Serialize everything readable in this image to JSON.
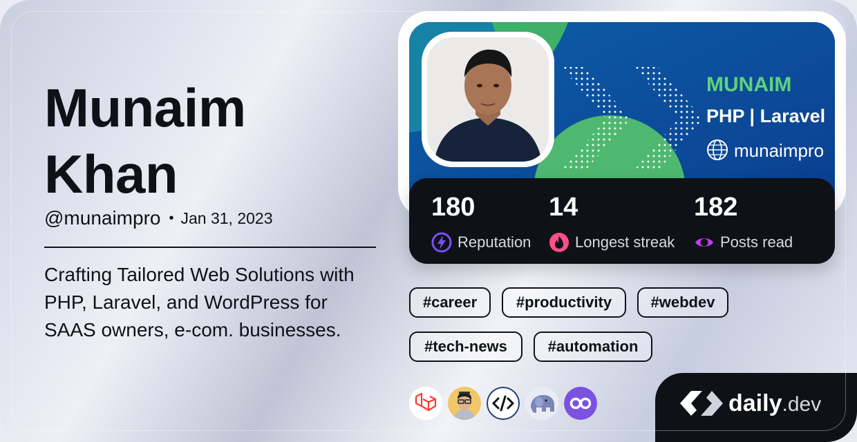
{
  "profile": {
    "first_name": "Munaim",
    "last_name": "Khan",
    "handle": "@munaimpro",
    "separator": "•",
    "joined": "Jan 31, 2023",
    "bio": "Crafting Tailored Web Solutions with PHP, Laravel, and WordPress for SAAS owners, e-com. businesses."
  },
  "cover": {
    "headline": "MUNAIM",
    "subline": "PHP | Laravel",
    "site": "munaimpro",
    "colors": {
      "background": "#0b3d8f",
      "accent": "#4fc16a",
      "headline": "#5ed27a"
    }
  },
  "stats": [
    {
      "value": "180",
      "label": "Reputation",
      "icon": "lightning-icon",
      "color": "#7b4dff"
    },
    {
      "value": "14",
      "label": "Longest streak",
      "icon": "flame-icon",
      "color": "#ff4f86"
    },
    {
      "value": "182",
      "label": "Posts read",
      "icon": "eye-icon",
      "color": "#c43cf0"
    }
  ],
  "tags": [
    "#career",
    "#productivity",
    "#webdev",
    "#tech-news",
    "#automation"
  ],
  "stack_icons": [
    "laravel-icon",
    "developer-avatar-icon",
    "code-icon",
    "php-elephant-icon",
    "infinity-icon"
  ],
  "brand": {
    "name": "daily",
    "tld": ".dev"
  }
}
